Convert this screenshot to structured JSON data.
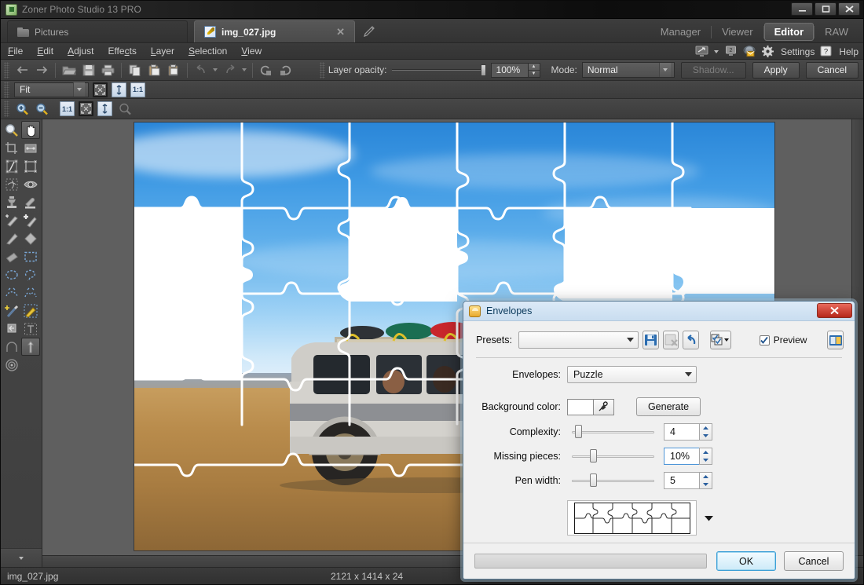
{
  "window": {
    "title": "Zoner Photo Studio 13 PRO",
    "icon": "app-logo-icon",
    "controls": {
      "minimize": "–",
      "maximize": "□",
      "close": "✕"
    }
  },
  "tabs": [
    {
      "label": "Pictures",
      "icon": "folder-icon",
      "active": false
    },
    {
      "label": "img_027.jpg",
      "icon": "edit-image-icon",
      "active": true,
      "close": "✕"
    }
  ],
  "modes": [
    {
      "label": "Manager",
      "active": false
    },
    {
      "label": "Viewer",
      "active": false
    },
    {
      "label": "Editor",
      "active": true
    },
    {
      "label": "RAW",
      "active": false
    }
  ],
  "menu": [
    "File",
    "Edit",
    "Adjust",
    "Effects",
    "Layer",
    "Selection",
    "View"
  ],
  "menu_right": {
    "display_icon": "monitor-icon",
    "dropdown_icon": "chevron-down-icon",
    "second_monitor_icon": "monitor-2-icon",
    "mail_icon": "mail-globe-icon",
    "settings_icon": "gear-icon",
    "settings_label": "Settings",
    "help_icon": "question-icon",
    "help_label": "Help"
  },
  "toolbar": {
    "buttons": [
      "back-icon",
      "forward-icon",
      "open-icon",
      "save-icon",
      "print-icon",
      "copy-icon",
      "paste-icon",
      "duplicate-icon",
      "undo-icon",
      "redo-icon",
      "rotate-left-icon",
      "rotate-right-icon"
    ],
    "layer_opacity_label": "Layer opacity:",
    "layer_opacity_value": "100%",
    "mode_label": "Mode:",
    "mode_value": "Normal",
    "shadow_label": "Shadow...",
    "apply_label": "Apply",
    "cancel_label": "Cancel"
  },
  "zoombar": {
    "zoom_value": "Fit",
    "fit_label": "fit-page-icon",
    "fit_height_label": "fit-height-icon",
    "one_to_one": "1:1",
    "zoom_in": "zoom-in-icon",
    "zoom_out": "zoom-out-icon",
    "magnifier": "magnifier-icon"
  },
  "tools": [
    "magnifier-tool",
    "hand-tool",
    "crop-tool",
    "perspective-tool",
    "straighten-tool",
    "transform-tool",
    "warp-tool",
    "red-eye-tool",
    "clone-stamp-tool",
    "smooth-tool",
    "retouch-tool",
    "heal-tool",
    "blur-tool",
    "smudge-tool",
    "eraser-tool",
    "rect-select-tool",
    "ellipse-select-tool",
    "lasso-select-tool",
    "magic-select-tool",
    "refine-select-tool",
    "magic-wand-tool",
    "paint-brush-tool",
    "fill-tool",
    "text-tool",
    "shape-tool",
    "gradient-tool",
    "effects-tool"
  ],
  "statusbar": {
    "filename": "img_027.jpg",
    "dimensions": "2121 x 1414 x 24"
  },
  "dialog": {
    "title": "Envelopes",
    "icon": "envelope-dialog-icon",
    "close": "✕",
    "presets_label": "Presets:",
    "presets_value": "",
    "preset_buttons": [
      "save-preset-icon",
      "delete-preset-icon",
      "reset-preset-icon",
      "preset-options-icon"
    ],
    "preview_label": "Preview",
    "preview_checked": true,
    "split_view_icon": "split-view-icon",
    "envelopes_label": "Envelopes:",
    "envelopes_value": "Puzzle",
    "background_color_label": "Background color:",
    "background_color_value": "#ffffff",
    "eyedropper_icon": "eyedropper-icon",
    "generate_label": "Generate",
    "complexity_label": "Complexity:",
    "complexity_value": "4",
    "complexity_pct": 4,
    "missing_pieces_label": "Missing pieces:",
    "missing_pieces_value": "10%",
    "missing_pieces_pct": 22,
    "pen_width_label": "Pen width:",
    "pen_width_value": "5",
    "pen_width_pct": 22,
    "pattern_dropdown_icon": "chevron-down-icon",
    "progress_value": 0,
    "ok_label": "OK",
    "cancel_label": "Cancel"
  },
  "colors": {
    "accent_blue": "#3c9fd6",
    "dialog_bg": "#f0f0f0",
    "app_bg": "#3a3a3a",
    "canvas_bg": "#5f5f5f",
    "puzzle_line": "#ffffff"
  }
}
